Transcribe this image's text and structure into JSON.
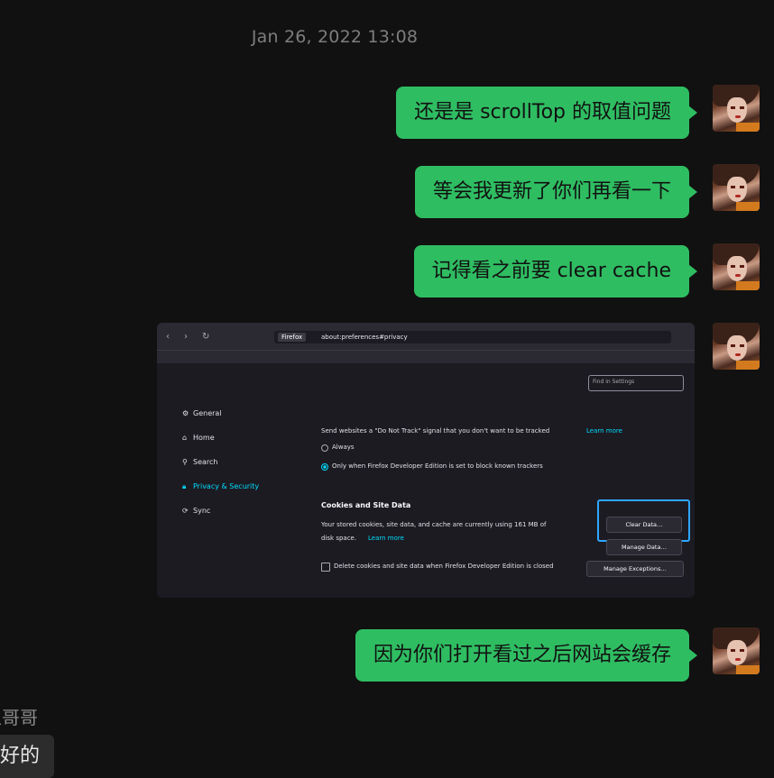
{
  "timestamp": "Jan 26, 2022 13:08",
  "messages": [
    {
      "text": "还是是 scrollTop 的取值问题"
    },
    {
      "text": "等会我更新了你们再看一下"
    },
    {
      "text": "记得看之前要 clear cache"
    },
    {
      "text": "因为你们打开看过之后网站会缓存"
    }
  ],
  "screenshot": {
    "browser_label": "Firefox",
    "url": "about:preferences#privacy",
    "find_placeholder": "Find in Settings",
    "nav": [
      "General",
      "Home",
      "Search",
      "Privacy & Security",
      "Sync"
    ],
    "dnt_text": "Send websites a \"Do Not Track\" signal that you don't want to be tracked",
    "learn_more": "Learn more",
    "always": "Always",
    "only_when": "Only when Firefox Developer Edition is set to block known trackers",
    "cookies_heading": "Cookies and Site Data",
    "cookies_desc_1": "Your stored cookies, site data, and cache are currently using 161 MB of",
    "cookies_desc_2": "disk space.",
    "delete_on_close": "Delete cookies and site data when Firefox Developer Edition is closed",
    "clear_data": "Clear Data…",
    "manage_data": "Manage Data…",
    "manage_exceptions": "Manage Exceptions…"
  },
  "peer": {
    "name": "王哥哥",
    "message": "好的"
  }
}
